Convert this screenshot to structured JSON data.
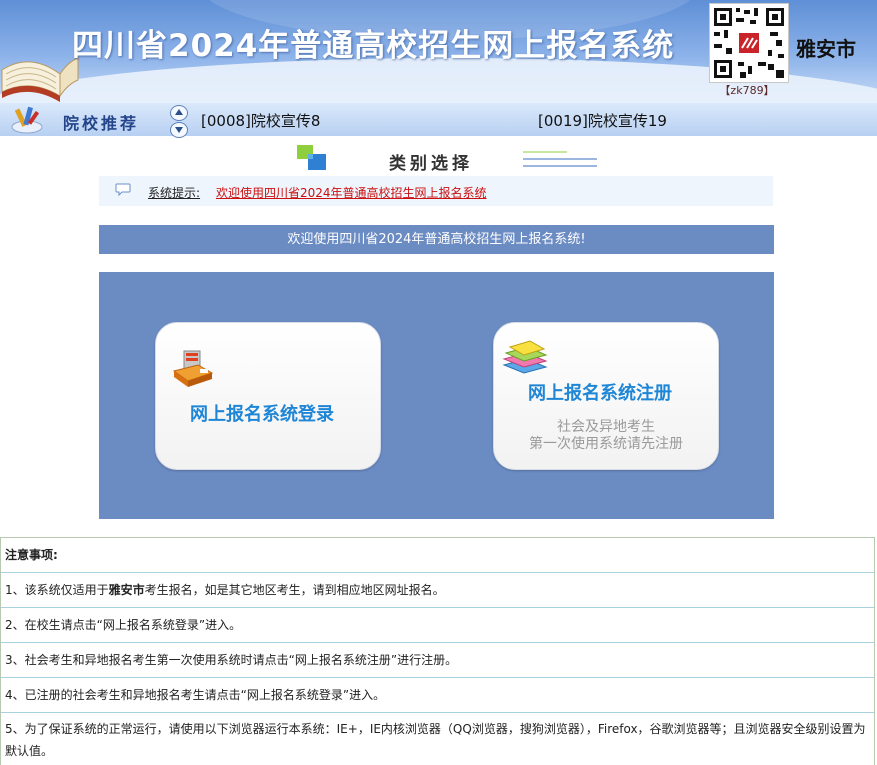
{
  "header": {
    "title": "四川省2024年普通高校招生网上报名系统",
    "qr_caption": "【zk789】",
    "city": "雅安市"
  },
  "recommend": {
    "label": "院校推荐",
    "items": [
      {
        "text": "[0008]院校宣传8"
      },
      {
        "text": "[0019]院校宣传19"
      }
    ]
  },
  "category": {
    "title": "类别选择"
  },
  "notice": {
    "label": "系统提示:",
    "message": "欢迎使用四川省2024年普通高校招生网上报名系统"
  },
  "welcome": {
    "text": "欢迎使用四川省2024年普通高校招生网上报名系统!"
  },
  "cards": {
    "login": {
      "title": "网上报名系统登录"
    },
    "register": {
      "title": "网上报名系统注册",
      "sub1": "社会及异地考生",
      "sub2": "第一次使用系统请先注册"
    }
  },
  "notes": {
    "heading": "注意事项:",
    "row1_pre": "1、该系统仅适用于",
    "row1_city": "雅安市",
    "row1_post": "考生报名，如是其它地区考生，请到相应地区网址报名。",
    "row2": "2、在校生请点击“网上报名系统登录”进入。",
    "row3": "3、社会考生和异地报名考生第一次使用系统时请点击“网上报名系统注册”进行注册。",
    "row4": "4、已注册的社会考生和异地报名考生请点击“网上报名系统登录”进入。",
    "row5": "5、为了保证系统的正常运行，请使用以下浏览器运行本系统：IE+，IE内核浏览器（QQ浏览器，搜狗浏览器），Firefox，谷歌浏览器等；且浏览器安全级别设置为默认值。"
  },
  "colors": {
    "panel": "#6b8bc3",
    "card_title": "#1f86d6",
    "notice_link": "#cc1010",
    "banner_top": "#5f8fd6"
  }
}
